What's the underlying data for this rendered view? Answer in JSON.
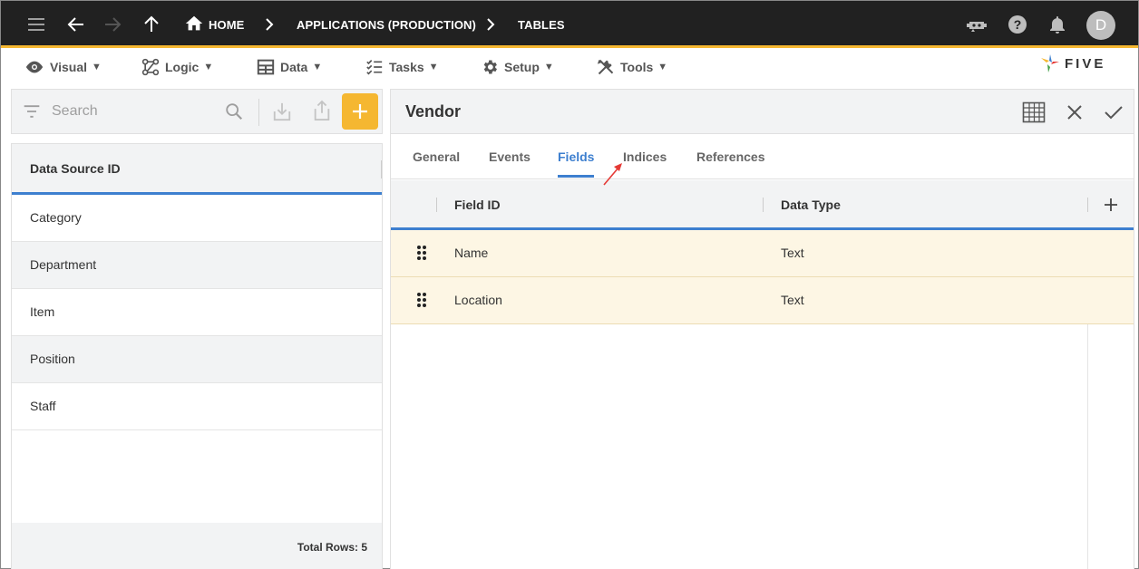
{
  "topbar": {
    "breadcrumbs": [
      "HOME",
      "APPLICATIONS (PRODUCTION)",
      "TABLES"
    ],
    "avatar_initial": "D",
    "icons": [
      "menu-icon",
      "back-arrow-icon",
      "forward-arrow-icon",
      "up-arrow-icon",
      "home-icon",
      "chevron-right-icon",
      "chat-bot-icon",
      "help-icon",
      "bell-icon"
    ]
  },
  "menubar": {
    "items": [
      {
        "label": "Visual",
        "icon": "eye-icon"
      },
      {
        "label": "Logic",
        "icon": "logic-icon"
      },
      {
        "label": "Data",
        "icon": "table-icon"
      },
      {
        "label": "Tasks",
        "icon": "checklist-icon"
      },
      {
        "label": "Setup",
        "icon": "gear-icon"
      },
      {
        "label": "Tools",
        "icon": "tools-icon"
      }
    ],
    "caret": "▼",
    "logo_text": "FIVE"
  },
  "left": {
    "search_placeholder": "Search",
    "column_header": "Data Source ID",
    "rows": [
      "Category",
      "Department",
      "Item",
      "Position",
      "Staff"
    ],
    "footer": "Total Rows: 5"
  },
  "right": {
    "title": "Vendor",
    "tabs": [
      "General",
      "Events",
      "Fields",
      "Indices",
      "References"
    ],
    "active_tab": "Fields",
    "columns": [
      "Field ID",
      "Data Type"
    ],
    "rows": [
      {
        "field_id": "Name",
        "data_type": "Text"
      },
      {
        "field_id": "Location",
        "data_type": "Text"
      }
    ]
  },
  "colors": {
    "topbar_bg": "#212121",
    "accent_yellow": "#f5b731",
    "accent_blue": "#3d7fcf",
    "row_highlight": "#fdf6e4",
    "annotation_red": "#e53935"
  }
}
